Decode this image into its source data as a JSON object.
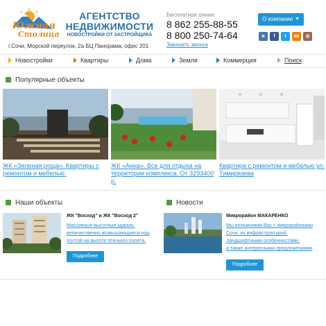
{
  "header": {
    "logo_line1": "Южная",
    "logo_line2": "Столица",
    "agency_title": "АГЕНТСТВО НЕДВИЖИМОСТИ",
    "agency_subtitle": "НОВОСТРОЙКИ ОТ ЗАСТРОЙЩИКА",
    "address": "г.Сочи, Морской переулок, 2а БЦ Панорама, офис 201",
    "hotline_label": "Бесплатная линия",
    "phone1": "8 862 255-88-55",
    "phone2": "8 800 250-74-64",
    "callback_label": "Заказать звонок",
    "about_label": "О компании",
    "about_arrow": "▼",
    "socials": [
      {
        "name": "vk",
        "glyph": "в",
        "color": "#4a76a8"
      },
      {
        "name": "facebook",
        "glyph": "f",
        "color": "#3b5998"
      },
      {
        "name": "twitter",
        "glyph": "t",
        "color": "#1da1f2"
      },
      {
        "name": "odnoklassniki",
        "glyph": "ок",
        "color": "#ee8208"
      },
      {
        "name": "instagram",
        "glyph": "◎",
        "color": "#9b6954"
      }
    ]
  },
  "nav": {
    "items": [
      "Новостройки",
      "Квартиры",
      "Дома",
      "Земля",
      "Коммерция"
    ],
    "search": "Поиск"
  },
  "popular": {
    "title": "Популярные объекты",
    "cards": [
      {
        "text": "ЖК «Зеленая роща». Квартиры с ремонтом и мебелью."
      },
      {
        "text": "ЖК «Анна». Все для отдыха на территории комплекса. От 3293400 р."
      },
      {
        "text": "Квартира с ремонтом и мебелью ул. Тимирязева"
      }
    ]
  },
  "objects": {
    "title": "Наши объекты",
    "item_title": "ЖК \"Восход\" и ЖК \"Восход 2\"",
    "desc_line1": "Массивные высотные здания,",
    "desc_line2": "величественно возвышающиеся над",
    "desc_line3": "Хостой на высоте птичьего полета.",
    "button": "Подробнее"
  },
  "news": {
    "title": "Новости",
    "item_title": "Микрорайон МАКАРЕНКО",
    "desc_line1": "Мы познакомим Вас с микрорайонами",
    "desc_line2": "Сочи, их инфраструктурой,",
    "desc_line3": "ландшафтными особенностями,",
    "desc_line4": "а также интересными предложениями",
    "button": "Подробнее"
  },
  "colors": {
    "accent": "#1f95d6",
    "link": "#2a8fd6",
    "brand_blue": "#2c6fa8",
    "logo_orange": "#e08a1e",
    "cube_green": "#4f9b3f"
  }
}
